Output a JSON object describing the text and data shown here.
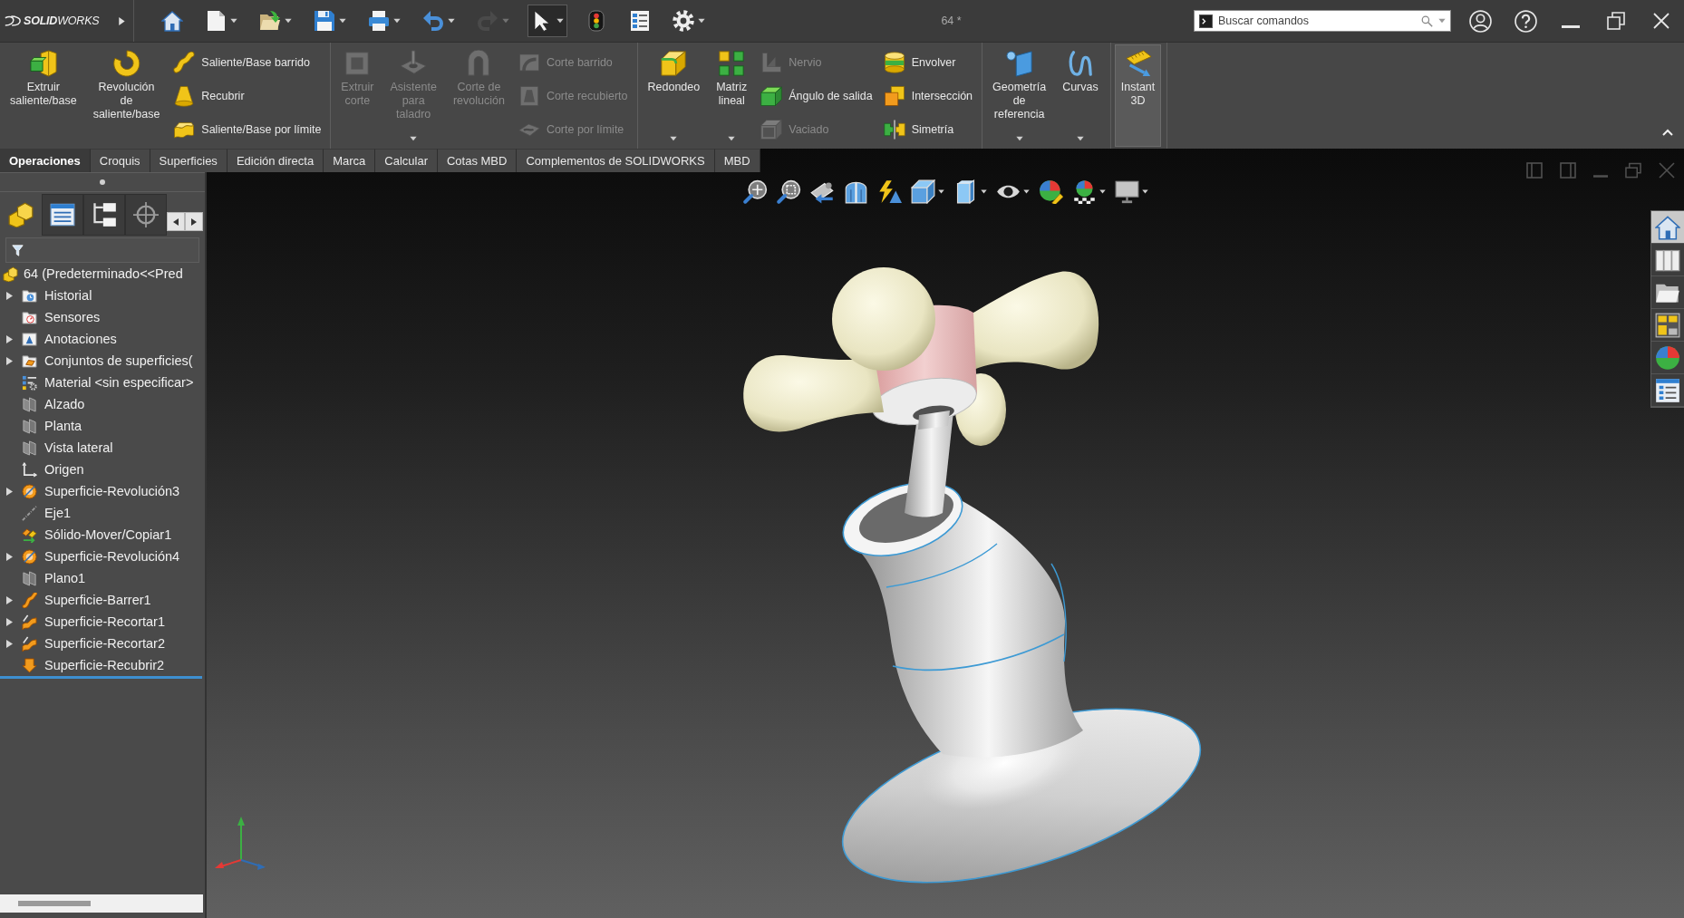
{
  "title_bar": {
    "logo": "**SOLID**WORKS",
    "quick_access": [
      {
        "kind": "home",
        "dropdown": false,
        "disabled": false,
        "selected": false
      },
      {
        "kind": "new",
        "dropdown": true,
        "disabled": false,
        "selected": false
      },
      {
        "kind": "open",
        "dropdown": true,
        "disabled": false,
        "selected": false
      },
      {
        "kind": "save",
        "dropdown": true,
        "disabled": false,
        "selected": false
      },
      {
        "kind": "print",
        "dropdown": true,
        "disabled": false,
        "selected": false
      },
      {
        "kind": "undo",
        "dropdown": true,
        "disabled": false,
        "selected": false
      },
      {
        "kind": "redo",
        "dropdown": true,
        "disabled": true,
        "selected": false
      },
      {
        "kind": "select",
        "dropdown": true,
        "disabled": false,
        "selected": true
      },
      {
        "kind": "rebuild",
        "dropdown": false,
        "disabled": false,
        "selected": false
      },
      {
        "kind": "file-properties",
        "dropdown": false,
        "disabled": false,
        "selected": false
      },
      {
        "kind": "options",
        "dropdown": true,
        "disabled": false,
        "selected": false
      }
    ],
    "document_title": "64 *",
    "search": {
      "placeholder": "Buscar comandos"
    }
  },
  "ribbon": {
    "groups": [
      {
        "buttons": [
          {
            "kind": "extrude",
            "label": "Extruir saliente/base",
            "disabled": false,
            "dropdown": false,
            "on": false
          },
          {
            "kind": "revolve",
            "label": "Revolución de saliente/base",
            "disabled": false,
            "dropdown": false,
            "on": false
          }
        ],
        "stacks": [
          {
            "buttons": [
              {
                "kind": "sweep",
                "label": "Saliente/Base barrido",
                "disabled": false
              },
              {
                "kind": "loft",
                "label": "Recubrir",
                "disabled": false
              },
              {
                "kind": "boundary",
                "label": "Saliente/Base por límite",
                "disabled": false
              }
            ]
          }
        ]
      },
      {
        "buttons": [
          {
            "kind": "cut-extrude",
            "label": "Extruir corte",
            "disabled": true,
            "dropdown": false,
            "on": false
          },
          {
            "kind": "hole-wizard",
            "label": "Asistente para taladro",
            "disabled": true,
            "dropdown": true,
            "on": false
          },
          {
            "kind": "cut-revolve",
            "label": "Corte de revolución",
            "disabled": true,
            "dropdown": false,
            "on": false
          }
        ],
        "stacks": [
          {
            "buttons": [
              {
                "kind": "cut-sweep",
                "label": "Corte barrido",
                "disabled": true
              },
              {
                "kind": "cut-loft",
                "label": "Corte recubierto",
                "disabled": true
              },
              {
                "kind": "cut-boundary",
                "label": "Corte por límite",
                "disabled": true
              }
            ]
          }
        ]
      },
      {
        "buttons": [
          {
            "kind": "fillet",
            "label": "Redondeo",
            "disabled": false,
            "dropdown": true,
            "on": false
          },
          {
            "kind": "linear-pattern",
            "label": "Matriz lineal",
            "disabled": false,
            "dropdown": true,
            "on": false
          }
        ],
        "stacks": [
          {
            "buttons": [
              {
                "kind": "rib",
                "label": "Nervio",
                "disabled": true
              },
              {
                "kind": "draft",
                "label": "Ángulo de salida",
                "disabled": false
              },
              {
                "kind": "shell",
                "label": "Vaciado",
                "disabled": true
              }
            ]
          },
          {
            "buttons": [
              {
                "kind": "wrap",
                "label": "Envolver",
                "disabled": false
              },
              {
                "kind": "intersect",
                "label": "Intersección",
                "disabled": false
              },
              {
                "kind": "mirror",
                "label": "Simetría",
                "disabled": false
              }
            ]
          }
        ]
      },
      {
        "buttons": [
          {
            "kind": "reference-geometry",
            "label": "Geometría de referencia",
            "disabled": false,
            "dropdown": true,
            "on": false
          },
          {
            "kind": "curves",
            "label": "Curvas",
            "disabled": false,
            "dropdown": true,
            "on": false
          }
        ]
      },
      {
        "buttons": [
          {
            "kind": "instant-3d",
            "label": "Instant 3D",
            "disabled": false,
            "dropdown": false,
            "on": true
          }
        ]
      }
    ]
  },
  "tabs": [
    {
      "label": "Operaciones",
      "selected": true
    },
    {
      "label": "Croquis",
      "selected": false
    },
    {
      "label": "Superficies",
      "selected": false
    },
    {
      "label": "Edición directa",
      "selected": false
    },
    {
      "label": "Marca",
      "selected": false
    },
    {
      "label": "Calcular",
      "selected": false
    },
    {
      "label": "Cotas MBD",
      "selected": false
    },
    {
      "label": "Complementos de SOLIDWORKS",
      "selected": false
    },
    {
      "label": "MBD",
      "selected": false
    }
  ],
  "feature_manager": {
    "panel_tabs": [
      {
        "kind": "features",
        "selected": true
      },
      {
        "kind": "properties",
        "selected": false
      },
      {
        "kind": "configurations",
        "selected": false
      },
      {
        "kind": "dimxpert",
        "selected": false
      }
    ],
    "tree": {
      "label": "64 (Predeterminado<<Pred",
      "kind": "part",
      "children": [
        {
          "label": "Historial",
          "kind": "history",
          "expandable": true,
          "expanded": false
        },
        {
          "label": "Sensores",
          "kind": "sensors",
          "expandable": false,
          "expanded": false
        },
        {
          "label": "Anotaciones",
          "kind": "annotations",
          "expandable": true,
          "expanded": false
        },
        {
          "label": "Conjuntos de superficies(",
          "kind": "surface-bodies",
          "expandable": true,
          "expanded": false
        },
        {
          "label": "Material <sin especificar>",
          "kind": "material",
          "expandable": false,
          "expanded": false
        },
        {
          "label": "Alzado",
          "kind": "plane",
          "expandable": false,
          "expanded": false
        },
        {
          "label": "Planta",
          "kind": "plane",
          "expandable": false,
          "expanded": false
        },
        {
          "label": "Vista lateral",
          "kind": "plane",
          "expandable": false,
          "expanded": false
        },
        {
          "label": "Origen",
          "kind": "origin",
          "expandable": false,
          "expanded": false
        },
        {
          "label": "Superficie-Revolución3",
          "kind": "surface-revolve",
          "expandable": true,
          "expanded": false
        },
        {
          "label": "Eje1",
          "kind": "axis",
          "expandable": false,
          "expanded": false
        },
        {
          "label": "Sólido-Mover/Copiar1",
          "kind": "move-copy",
          "expandable": false,
          "expanded": false
        },
        {
          "label": "Superficie-Revolución4",
          "kind": "surface-revolve",
          "expandable": true,
          "expanded": false
        },
        {
          "label": "Plano1",
          "kind": "plane",
          "expandable": false,
          "expanded": false
        },
        {
          "label": "Superficie-Barrer1",
          "kind": "surface-sweep",
          "expandable": true,
          "expanded": false
        },
        {
          "label": "Superficie-Recortar1",
          "kind": "surface-trim",
          "expandable": true,
          "expanded": false
        },
        {
          "label": "Superficie-Recortar2",
          "kind": "surface-trim",
          "expandable": true,
          "expanded": false
        },
        {
          "label": "Superficie-Recubrir2",
          "kind": "surface-loft",
          "expandable": false,
          "expanded": false
        }
      ]
    }
  },
  "viewport": {
    "view_toolbar": [
      {
        "kind": "zoom-to-fit",
        "dropdown": false
      },
      {
        "kind": "zoom-to-area",
        "dropdown": false
      },
      {
        "kind": "previous-view",
        "dropdown": false
      },
      {
        "kind": "section-view",
        "dropdown": false
      },
      {
        "kind": "dynamic-annotation",
        "dropdown": false
      },
      {
        "kind": "view-orientation",
        "dropdown": true
      },
      {
        "kind": "display-style",
        "dropdown": true
      },
      {
        "kind": "hide-show",
        "dropdown": true
      },
      {
        "kind": "edit-appearance",
        "dropdown": false
      },
      {
        "kind": "apply-scene",
        "dropdown": true
      },
      {
        "kind": "view-settings",
        "dropdown": true
      }
    ],
    "task_pane": [
      {
        "kind": "resources",
        "selected": true
      },
      {
        "kind": "design-library",
        "selected": false
      },
      {
        "kind": "file-explorer",
        "selected": false
      },
      {
        "kind": "view-palette",
        "selected": false
      },
      {
        "kind": "appearances",
        "selected": false
      },
      {
        "kind": "custom-properties",
        "selected": false
      }
    ]
  }
}
